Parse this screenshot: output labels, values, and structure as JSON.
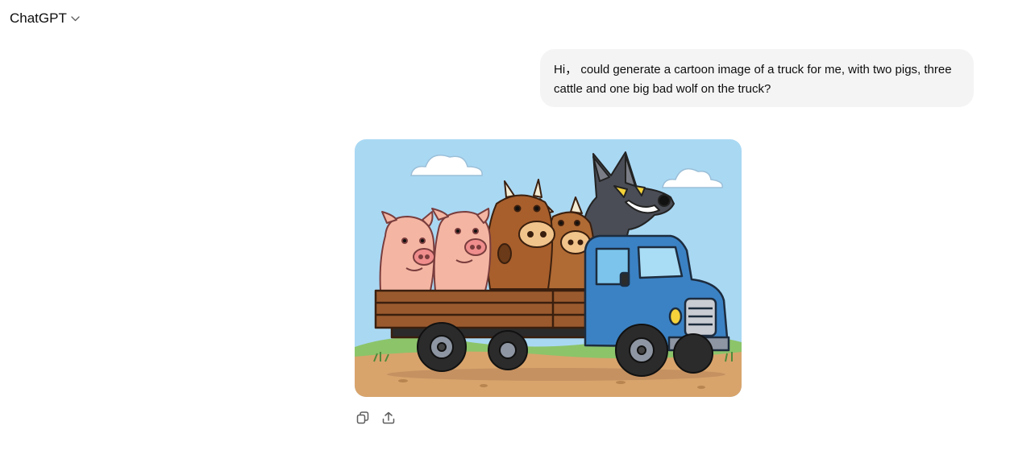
{
  "header": {
    "model_name": "ChatGPT",
    "chevron_icon": "chevron-down-icon"
  },
  "conversation": {
    "user_message": {
      "text": "Hi， could generate a cartoon image of a truck for me, with two pigs, three cattle and one big bad wolf on the truck?"
    },
    "assistant_message": {
      "image": {
        "subject": "cartoon truck carrying two pigs, three cattle and a big bad wolf"
      },
      "actions": [
        {
          "icon": "copy-icon"
        },
        {
          "icon": "share-icon"
        }
      ]
    }
  },
  "colors": {
    "bubble_bg": "#f4f4f4",
    "icon_gray": "#5d5d5d",
    "sky": "#a9d8f3",
    "truck_blue": "#3b82c4",
    "crate_wood": "#9a5a2e"
  }
}
